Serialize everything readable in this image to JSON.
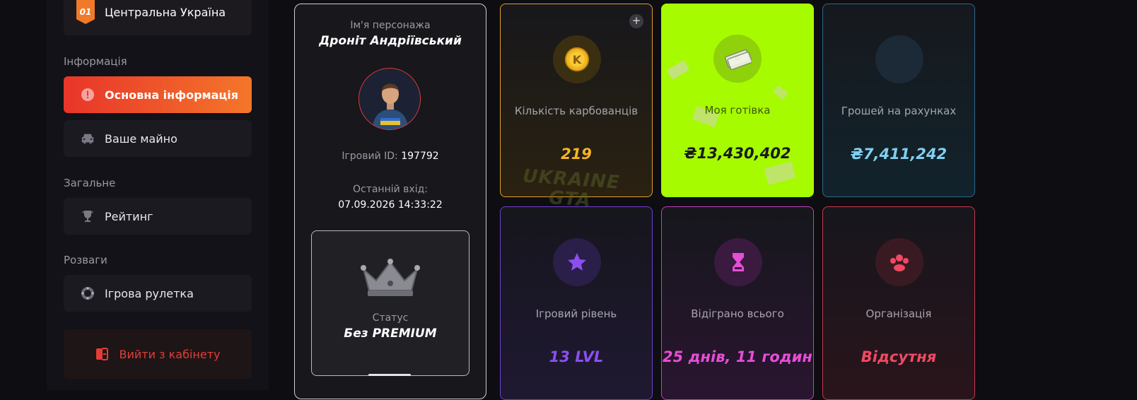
{
  "sidebar": {
    "server": {
      "number": "01",
      "name": "Центральна Україна"
    },
    "sections": {
      "info": "Інформація",
      "general": "Загальне",
      "fun": "Розваги"
    },
    "items": {
      "basic_info": "Основна інформація",
      "property": "Ваше майно",
      "rating": "Рейтинг",
      "roulette": "Ігрова рулетка",
      "logout": "Вийти з кабінету"
    }
  },
  "profile": {
    "name_label": "Ім'я персонажа",
    "name": "Дроніт Андріївський",
    "id_label": "Ігровий ID:",
    "id": "197792",
    "last_login_label": "Останній вхід:",
    "last_login": "07.09.2026 14:33:22",
    "status_label": "Статус",
    "status": "Без PREMIUM"
  },
  "stats": {
    "karbovanets": {
      "label": "Кількість карбованців",
      "value": "219",
      "color": "#f6b426"
    },
    "cash": {
      "label": "Моя готівка",
      "value": "₴13,430,402",
      "color": "#1a1a1a"
    },
    "bank": {
      "label": "Грошей на рахунках",
      "value": "₴7,411,242",
      "color": "#7fd0f0"
    },
    "level": {
      "label": "Ігровий рівень",
      "value": "13 LVL",
      "color": "#8b4ff0"
    },
    "played": {
      "label": "Відіграно всього",
      "value": "25 днів, 11 годин",
      "color": "#e64ed6"
    },
    "org": {
      "label": "Організація",
      "value": "Відсутня",
      "color": "#ef4a62"
    }
  },
  "icons": {
    "server_badge": "shield-badge-icon",
    "alert": "alert-icon",
    "car": "car-icon",
    "trophy": "trophy-icon",
    "roulette": "roulette-icon",
    "logout": "logout-icon",
    "plus": "plus-icon",
    "coin": "coin-icon",
    "cash": "cash-icon",
    "star": "star-icon",
    "hourglass": "hourglass-icon",
    "group": "group-icon",
    "crown": "crown-icon"
  },
  "watermark": "UKRAINE GTA"
}
